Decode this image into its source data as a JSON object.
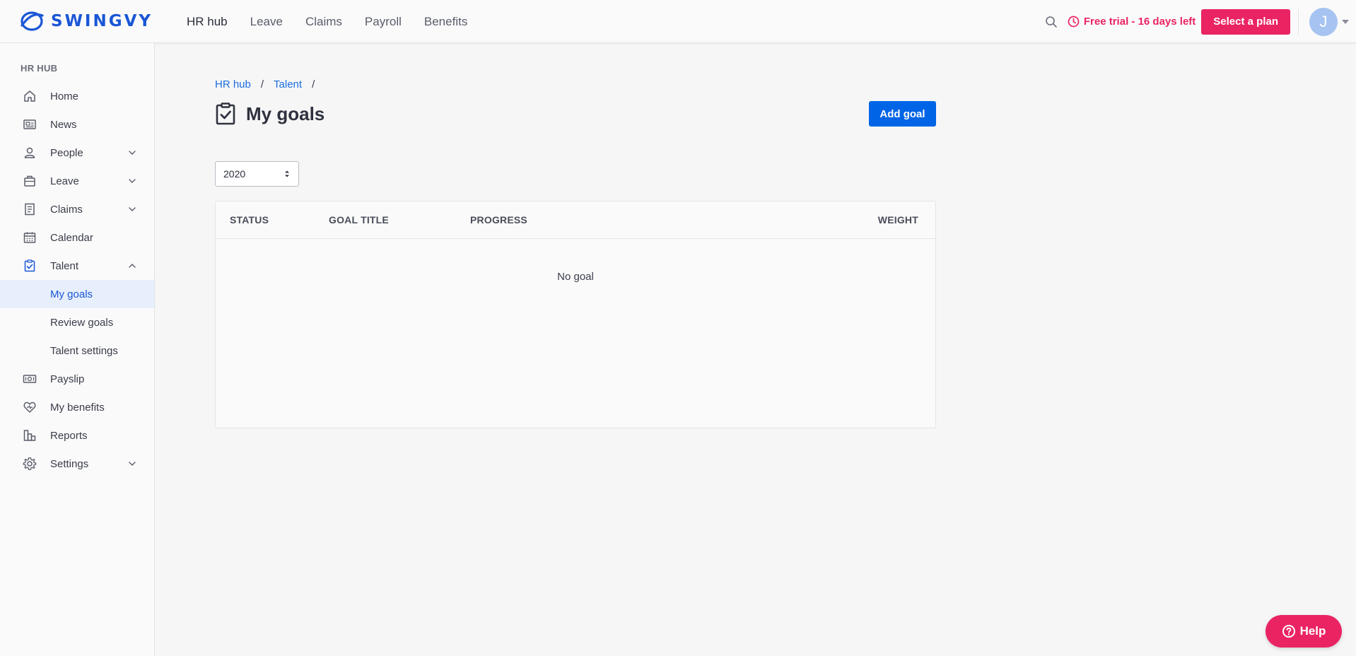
{
  "brand": {
    "name": "SWINGVY",
    "color": "#1a56d6"
  },
  "topnav": {
    "items": [
      {
        "label": "HR hub",
        "active": true
      },
      {
        "label": "Leave"
      },
      {
        "label": "Claims"
      },
      {
        "label": "Payroll"
      },
      {
        "label": "Benefits"
      }
    ]
  },
  "header": {
    "search_icon": "search-icon",
    "trial_text": "Free trial - 16 days left",
    "trial_icon": "clock-icon",
    "select_plan_label": "Select a plan",
    "avatar_initial": "J",
    "accent_color": "#ea2463"
  },
  "sidebar": {
    "heading": "HR HUB",
    "items": [
      {
        "label": "Home",
        "icon": "home-icon"
      },
      {
        "label": "News",
        "icon": "newspaper-icon"
      },
      {
        "label": "People",
        "icon": "person-icon",
        "expandable": true
      },
      {
        "label": "Leave",
        "icon": "briefcase-icon",
        "expandable": true
      },
      {
        "label": "Claims",
        "icon": "receipt-icon",
        "expandable": true
      },
      {
        "label": "Calendar",
        "icon": "calendar-icon"
      },
      {
        "label": "Talent",
        "icon": "clipboard-check-icon",
        "expanded": true
      },
      {
        "label": "My goals",
        "sub": true,
        "selected": true
      },
      {
        "label": "Review goals",
        "sub": true
      },
      {
        "label": "Talent settings",
        "sub": true
      },
      {
        "label": "Payslip",
        "icon": "money-icon"
      },
      {
        "label": "My benefits",
        "icon": "heart-icon"
      },
      {
        "label": "Reports",
        "icon": "bar-chart-icon"
      },
      {
        "label": "Settings",
        "icon": "gear-icon",
        "expandable": true
      }
    ]
  },
  "main": {
    "breadcrumb": [
      "HR hub",
      "Talent"
    ],
    "breadcrumb_sep": "/",
    "title": "My goals",
    "title_icon": "clipboard-check-icon",
    "add_goal_label": "Add goal",
    "year_select": {
      "value": "2020"
    },
    "table": {
      "columns": [
        "STATUS",
        "GOAL TITLE",
        "PROGRESS",
        "WEIGHT"
      ],
      "empty_text": "No goal"
    }
  },
  "help": {
    "label": "Help",
    "icon": "help-circle-icon"
  },
  "primary_color": "#0064e6"
}
